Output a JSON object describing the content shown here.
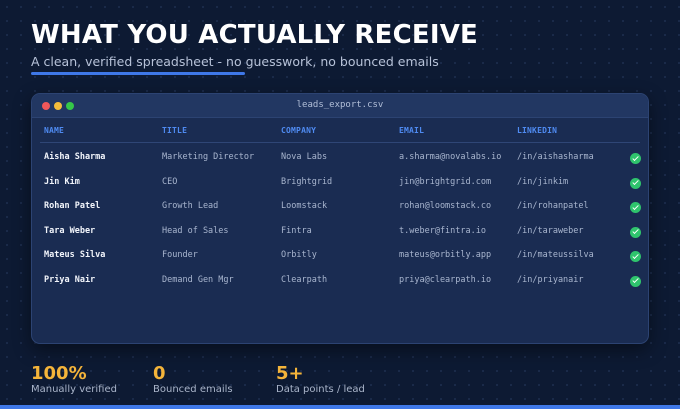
{
  "header": {
    "title": "WHAT YOU ACTUALLY RECEIVE",
    "subtitle": "A clean, verified spreadsheet - no guesswork, no bounced emails"
  },
  "window": {
    "filename": "leads_export.csv"
  },
  "table": {
    "columns": [
      "NAME",
      "TITLE",
      "COMPANY",
      "EMAIL",
      "LINKEDIN"
    ],
    "rows": [
      {
        "name": "Aisha Sharma",
        "title": "Marketing Director",
        "company": "Nova Labs",
        "email": "a.sharma@novalabs.io",
        "linkedin": "/in/aishasharma",
        "verified": true
      },
      {
        "name": "Jin Kim",
        "title": "CEO",
        "company": "Brightgrid",
        "email": "jin@brightgrid.com",
        "linkedin": "/in/jinkim",
        "verified": true
      },
      {
        "name": "Rohan Patel",
        "title": "Growth Lead",
        "company": "Loomstack",
        "email": "rohan@loomstack.co",
        "linkedin": "/in/rohanpatel",
        "verified": true
      },
      {
        "name": "Tara Weber",
        "title": "Head of Sales",
        "company": "Fintra",
        "email": "t.weber@fintra.io",
        "linkedin": "/in/taraweber",
        "verified": true
      },
      {
        "name": "Mateus Silva",
        "title": "Founder",
        "company": "Orbitly",
        "email": "mateus@orbitly.app",
        "linkedin": "/in/mateussilva",
        "verified": true
      },
      {
        "name": "Priya Nair",
        "title": "Demand Gen Mgr",
        "company": "Clearpath",
        "email": "priya@clearpath.io",
        "linkedin": "/in/priyanair",
        "verified": true
      }
    ]
  },
  "stats": [
    {
      "value": "100%",
      "label": "Manually verified"
    },
    {
      "value": "0",
      "label": "Bounced emails"
    },
    {
      "value": "5+",
      "label": "Data points / lead"
    }
  ],
  "colors": {
    "background": "#0d1a33",
    "accent": "#3f78e8",
    "header_text": "#4f8bf2",
    "stat_value": "#f4b43a",
    "verified": "#2fc46d"
  },
  "icons": {
    "verified": "check-circle-icon"
  }
}
